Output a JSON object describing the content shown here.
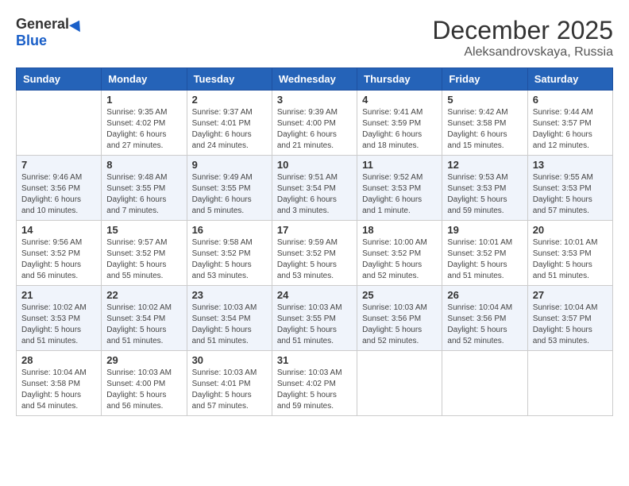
{
  "logo": {
    "general": "General",
    "blue": "Blue"
  },
  "title": "December 2025",
  "location": "Aleksandrovskaya, Russia",
  "days_of_week": [
    "Sunday",
    "Monday",
    "Tuesday",
    "Wednesday",
    "Thursday",
    "Friday",
    "Saturday"
  ],
  "weeks": [
    [
      {
        "day": "",
        "sunrise": "",
        "sunset": "",
        "daylight": ""
      },
      {
        "day": "1",
        "sunrise": "Sunrise: 9:35 AM",
        "sunset": "Sunset: 4:02 PM",
        "daylight": "Daylight: 6 hours and 27 minutes."
      },
      {
        "day": "2",
        "sunrise": "Sunrise: 9:37 AM",
        "sunset": "Sunset: 4:01 PM",
        "daylight": "Daylight: 6 hours and 24 minutes."
      },
      {
        "day": "3",
        "sunrise": "Sunrise: 9:39 AM",
        "sunset": "Sunset: 4:00 PM",
        "daylight": "Daylight: 6 hours and 21 minutes."
      },
      {
        "day": "4",
        "sunrise": "Sunrise: 9:41 AM",
        "sunset": "Sunset: 3:59 PM",
        "daylight": "Daylight: 6 hours and 18 minutes."
      },
      {
        "day": "5",
        "sunrise": "Sunrise: 9:42 AM",
        "sunset": "Sunset: 3:58 PM",
        "daylight": "Daylight: 6 hours and 15 minutes."
      },
      {
        "day": "6",
        "sunrise": "Sunrise: 9:44 AM",
        "sunset": "Sunset: 3:57 PM",
        "daylight": "Daylight: 6 hours and 12 minutes."
      }
    ],
    [
      {
        "day": "7",
        "sunrise": "Sunrise: 9:46 AM",
        "sunset": "Sunset: 3:56 PM",
        "daylight": "Daylight: 6 hours and 10 minutes."
      },
      {
        "day": "8",
        "sunrise": "Sunrise: 9:48 AM",
        "sunset": "Sunset: 3:55 PM",
        "daylight": "Daylight: 6 hours and 7 minutes."
      },
      {
        "day": "9",
        "sunrise": "Sunrise: 9:49 AM",
        "sunset": "Sunset: 3:55 PM",
        "daylight": "Daylight: 6 hours and 5 minutes."
      },
      {
        "day": "10",
        "sunrise": "Sunrise: 9:51 AM",
        "sunset": "Sunset: 3:54 PM",
        "daylight": "Daylight: 6 hours and 3 minutes."
      },
      {
        "day": "11",
        "sunrise": "Sunrise: 9:52 AM",
        "sunset": "Sunset: 3:53 PM",
        "daylight": "Daylight: 6 hours and 1 minute."
      },
      {
        "day": "12",
        "sunrise": "Sunrise: 9:53 AM",
        "sunset": "Sunset: 3:53 PM",
        "daylight": "Daylight: 5 hours and 59 minutes."
      },
      {
        "day": "13",
        "sunrise": "Sunrise: 9:55 AM",
        "sunset": "Sunset: 3:53 PM",
        "daylight": "Daylight: 5 hours and 57 minutes."
      }
    ],
    [
      {
        "day": "14",
        "sunrise": "Sunrise: 9:56 AM",
        "sunset": "Sunset: 3:52 PM",
        "daylight": "Daylight: 5 hours and 56 minutes."
      },
      {
        "day": "15",
        "sunrise": "Sunrise: 9:57 AM",
        "sunset": "Sunset: 3:52 PM",
        "daylight": "Daylight: 5 hours and 55 minutes."
      },
      {
        "day": "16",
        "sunrise": "Sunrise: 9:58 AM",
        "sunset": "Sunset: 3:52 PM",
        "daylight": "Daylight: 5 hours and 53 minutes."
      },
      {
        "day": "17",
        "sunrise": "Sunrise: 9:59 AM",
        "sunset": "Sunset: 3:52 PM",
        "daylight": "Daylight: 5 hours and 53 minutes."
      },
      {
        "day": "18",
        "sunrise": "Sunrise: 10:00 AM",
        "sunset": "Sunset: 3:52 PM",
        "daylight": "Daylight: 5 hours and 52 minutes."
      },
      {
        "day": "19",
        "sunrise": "Sunrise: 10:01 AM",
        "sunset": "Sunset: 3:52 PM",
        "daylight": "Daylight: 5 hours and 51 minutes."
      },
      {
        "day": "20",
        "sunrise": "Sunrise: 10:01 AM",
        "sunset": "Sunset: 3:53 PM",
        "daylight": "Daylight: 5 hours and 51 minutes."
      }
    ],
    [
      {
        "day": "21",
        "sunrise": "Sunrise: 10:02 AM",
        "sunset": "Sunset: 3:53 PM",
        "daylight": "Daylight: 5 hours and 51 minutes."
      },
      {
        "day": "22",
        "sunrise": "Sunrise: 10:02 AM",
        "sunset": "Sunset: 3:54 PM",
        "daylight": "Daylight: 5 hours and 51 minutes."
      },
      {
        "day": "23",
        "sunrise": "Sunrise: 10:03 AM",
        "sunset": "Sunset: 3:54 PM",
        "daylight": "Daylight: 5 hours and 51 minutes."
      },
      {
        "day": "24",
        "sunrise": "Sunrise: 10:03 AM",
        "sunset": "Sunset: 3:55 PM",
        "daylight": "Daylight: 5 hours and 51 minutes."
      },
      {
        "day": "25",
        "sunrise": "Sunrise: 10:03 AM",
        "sunset": "Sunset: 3:56 PM",
        "daylight": "Daylight: 5 hours and 52 minutes."
      },
      {
        "day": "26",
        "sunrise": "Sunrise: 10:04 AM",
        "sunset": "Sunset: 3:56 PM",
        "daylight": "Daylight: 5 hours and 52 minutes."
      },
      {
        "day": "27",
        "sunrise": "Sunrise: 10:04 AM",
        "sunset": "Sunset: 3:57 PM",
        "daylight": "Daylight: 5 hours and 53 minutes."
      }
    ],
    [
      {
        "day": "28",
        "sunrise": "Sunrise: 10:04 AM",
        "sunset": "Sunset: 3:58 PM",
        "daylight": "Daylight: 5 hours and 54 minutes."
      },
      {
        "day": "29",
        "sunrise": "Sunrise: 10:03 AM",
        "sunset": "Sunset: 4:00 PM",
        "daylight": "Daylight: 5 hours and 56 minutes."
      },
      {
        "day": "30",
        "sunrise": "Sunrise: 10:03 AM",
        "sunset": "Sunset: 4:01 PM",
        "daylight": "Daylight: 5 hours and 57 minutes."
      },
      {
        "day": "31",
        "sunrise": "Sunrise: 10:03 AM",
        "sunset": "Sunset: 4:02 PM",
        "daylight": "Daylight: 5 hours and 59 minutes."
      },
      {
        "day": "",
        "sunrise": "",
        "sunset": "",
        "daylight": ""
      },
      {
        "day": "",
        "sunrise": "",
        "sunset": "",
        "daylight": ""
      },
      {
        "day": "",
        "sunrise": "",
        "sunset": "",
        "daylight": ""
      }
    ]
  ]
}
